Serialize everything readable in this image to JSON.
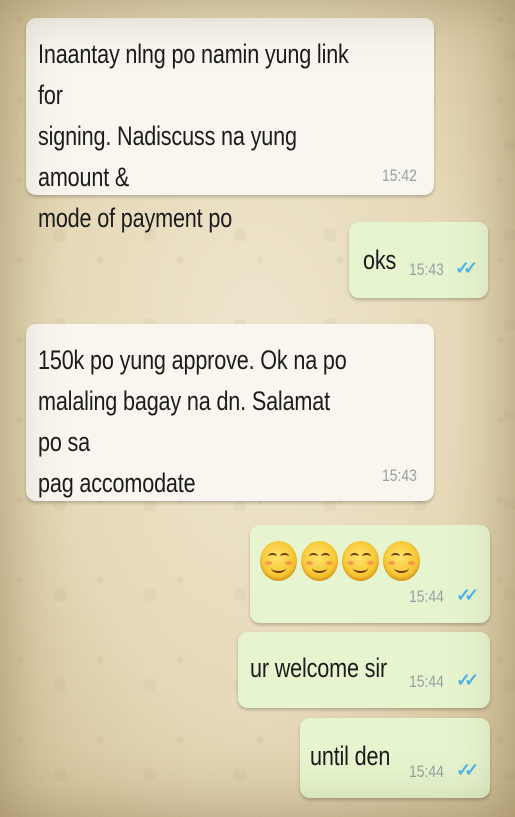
{
  "chat": {
    "messages": [
      {
        "direction": "incoming",
        "text": "Inaantay nlng po namin yung link for\nsigning. Nadiscuss na yung amount &\nmode of payment po",
        "time": "15:42"
      },
      {
        "direction": "outgoing",
        "text": "oks",
        "time": "15:43",
        "status": "read"
      },
      {
        "direction": "incoming",
        "text": "150k po yung approve. Ok na po\nmalaling bagay na dn. Salamat po sa\npag accomodate",
        "time": "15:43"
      },
      {
        "direction": "outgoing",
        "emoji": [
          "smiling-face-with-smiling-eyes",
          "smiling-face-with-smiling-eyes",
          "smiling-face-with-smiling-eyes",
          "smiling-face-with-smiling-eyes"
        ],
        "time": "15:44",
        "status": "read"
      },
      {
        "direction": "outgoing",
        "text": "ur welcome sir",
        "time": "15:44",
        "status": "read"
      },
      {
        "direction": "outgoing",
        "text": "until den",
        "time": "15:44",
        "status": "read"
      }
    ]
  },
  "colors": {
    "incoming_bubble": "#f8f6ef",
    "outgoing_bubble": "#e6f5cf",
    "read_ticks": "#4db6e8",
    "timestamp": "#9aa0a0"
  },
  "icons": {
    "read_receipt": "double-check-icon"
  }
}
